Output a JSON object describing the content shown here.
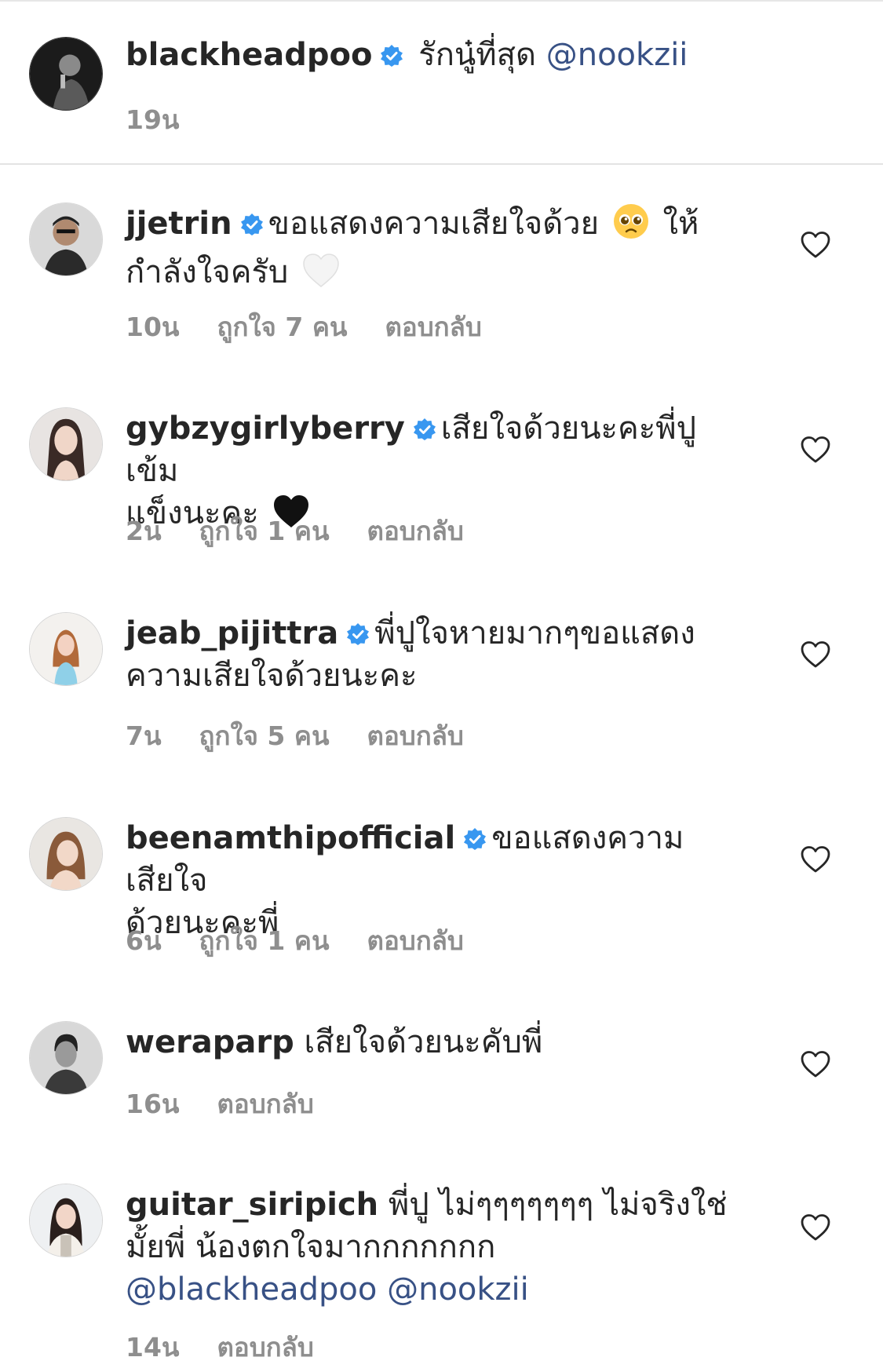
{
  "caption": {
    "username": "blackheadpoo",
    "text": "รักนู๋ที่สุด",
    "mention": "@nookzii",
    "time": "19น"
  },
  "comments": [
    {
      "username": "jjetrin",
      "text_line1": "ขอแสดงความเสียใจด้วย",
      "text_line1_after_emoji": "ให้",
      "text_line2": "กำลังใจครับ",
      "emoji1": "pleading-face",
      "emoji2": "white-heart",
      "time": "10น",
      "likes": "ถูกใจ 7 คน",
      "reply": "ตอบกลับ"
    },
    {
      "username": "gybzygirlyberry",
      "text_line1": "เสียใจด้วยนะคะพี่ปู เข้ม",
      "text_line2": "แข็งนะคะ",
      "emoji": "black-heart",
      "time": "2น",
      "likes": "ถูกใจ 1 คน",
      "reply": "ตอบกลับ"
    },
    {
      "username": "jeab_pijittra",
      "text_line1": "พี่ปูใจหายมากๆขอแสดง",
      "text_line2": "ความเสียใจด้วยนะคะ",
      "time": "7น",
      "likes": "ถูกใจ 5 คน",
      "reply": "ตอบกลับ"
    },
    {
      "username": "beenamthipofficial",
      "text_line1": "ขอแสดงความเสียใจ",
      "text_line2": "ด้วยนะคะพี่",
      "time": "6น",
      "likes": "ถูกใจ 1 คน",
      "reply": "ตอบกลับ"
    },
    {
      "username": "weraparp",
      "text_line1": "เสียใจด้วยนะคับพี่",
      "time": "16น",
      "reply": "ตอบกลับ"
    },
    {
      "username": "guitar_siripich",
      "text_line1": "พี่ปู ไม่ๆๆๆๆๆๆๆ ไม่จริงใช่",
      "text_line2": "มั้ยพี่ น้องตกใจมากกกกกกก",
      "mention1": "@blackheadpoo",
      "mention2": "@nookzii",
      "time": "14น",
      "reply": "ตอบกลับ"
    }
  ],
  "colors": {
    "text": "#262626",
    "meta": "#8e8e8e",
    "mention": "#385185",
    "verified": "#3897f0",
    "divider": "#e3e3e3"
  }
}
